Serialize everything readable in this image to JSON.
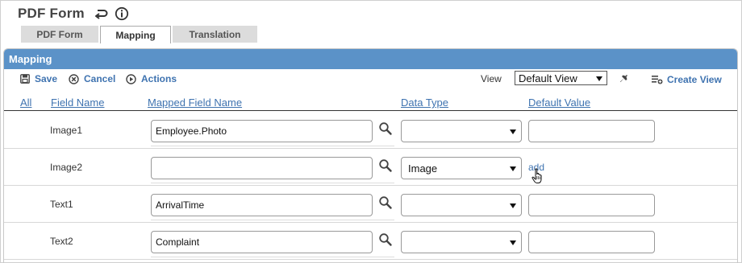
{
  "page": {
    "title": "PDF Form"
  },
  "tabs": [
    {
      "label": "PDF Form"
    },
    {
      "label": "Mapping"
    },
    {
      "label": "Translation"
    }
  ],
  "panel": {
    "title": "Mapping"
  },
  "toolbar": {
    "save_label": "Save",
    "cancel_label": "Cancel",
    "actions_label": "Actions",
    "view_label": "View",
    "view_selected": "Default View",
    "create_view_label": "Create View"
  },
  "columns": {
    "all": "All",
    "field_name": "Field Name",
    "mapped_field_name": "Mapped Field Name",
    "data_type": "Data Type",
    "default_value": "Default Value"
  },
  "rows": [
    {
      "field_name": "Image1",
      "mapped_value": "Employee.Photo",
      "data_type": "",
      "default_value": ""
    },
    {
      "field_name": "Image2",
      "mapped_value": "",
      "data_type": "Image",
      "default_action": "add"
    },
    {
      "field_name": "Text1",
      "mapped_value": "ArrivalTime",
      "data_type": "",
      "default_value": ""
    },
    {
      "field_name": "Text2",
      "mapped_value": "Complaint",
      "data_type": "",
      "default_value": ""
    }
  ],
  "colors": {
    "accent": "#3f73b0",
    "header_bar": "#5b92c8",
    "tab_inactive": "#dcdcdc"
  },
  "icons": {
    "undo": "undo-icon",
    "info": "info-icon",
    "save": "save-icon",
    "cancel": "cancel-icon",
    "actions": "play-icon",
    "pin": "pin-icon",
    "create_view": "create-view-icon",
    "search": "search-icon",
    "cursor": "hand-cursor-icon"
  }
}
